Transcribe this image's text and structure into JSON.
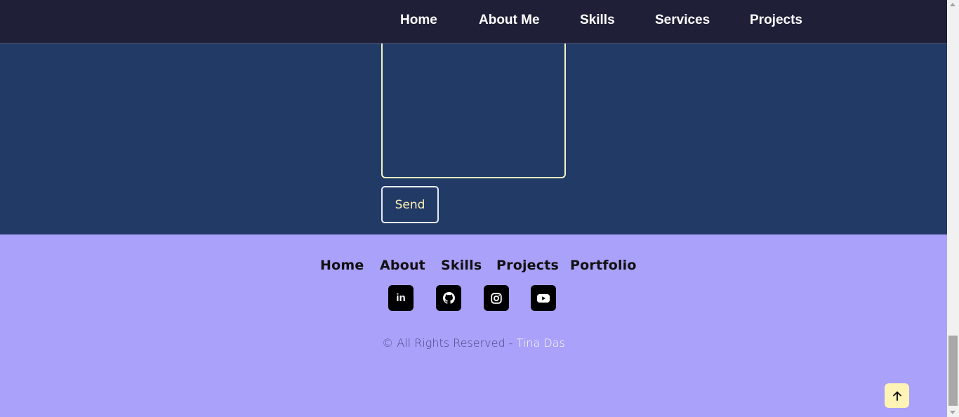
{
  "nav": {
    "items": [
      "Home",
      "About Me",
      "Skills",
      "Services",
      "Projects"
    ]
  },
  "contact": {
    "send_label": "Send"
  },
  "footer": {
    "links": [
      "Home",
      "About",
      "Skills",
      "Projects",
      "Portfolio"
    ],
    "social": [
      {
        "icon": "linkedin-icon",
        "glyph": "in"
      },
      {
        "icon": "github-icon"
      },
      {
        "icon": "instagram-icon"
      },
      {
        "icon": "youtube-icon"
      }
    ],
    "copyright_prefix": "© All Rights Reserved - ",
    "copyright_author": "Tina Das"
  },
  "colors": {
    "nav_bg": "#1f1f38",
    "contact_bg": "#223a66",
    "footer_bg": "#a9a1fa",
    "accent": "#fff3b5"
  }
}
